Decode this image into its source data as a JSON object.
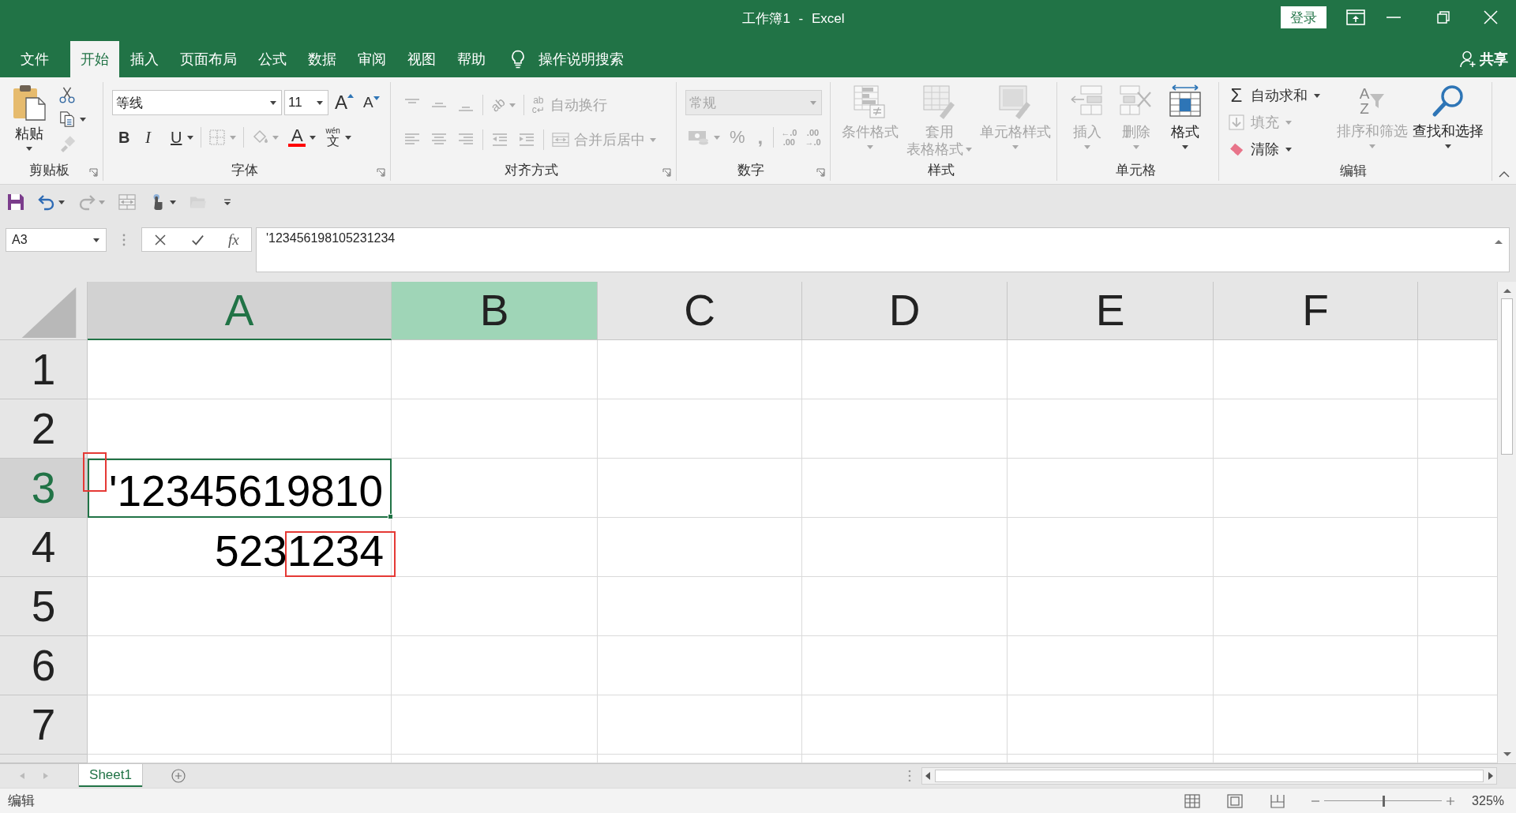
{
  "window": {
    "title": "工作簿1 - Excel",
    "sign_in": "登录"
  },
  "ribbon_tabs": [
    {
      "label": "文件",
      "selected": false
    },
    {
      "label": "开始",
      "selected": true
    },
    {
      "label": "插入",
      "selected": false
    },
    {
      "label": "页面布局",
      "selected": false
    },
    {
      "label": "公式",
      "selected": false
    },
    {
      "label": "数据",
      "selected": false
    },
    {
      "label": "审阅",
      "selected": false
    },
    {
      "label": "视图",
      "selected": false
    },
    {
      "label": "帮助",
      "selected": false
    }
  ],
  "tell_me": {
    "label": "操作说明搜索"
  },
  "share": {
    "label": "共享"
  },
  "ribbon": {
    "clipboard": {
      "label": "剪贴板",
      "paste": {
        "label": "粘贴",
        "disabled": false
      },
      "cut": {
        "disabled": false
      },
      "copy": {
        "disabled": false
      },
      "format_painter": {
        "disabled": true
      }
    },
    "font": {
      "label": "字体",
      "font_name": {
        "value": "等线"
      },
      "font_size": {
        "value": "11"
      },
      "grow": {
        "glyph": "A",
        "disabled": false
      },
      "shrink": {
        "glyph": "A",
        "disabled": false
      },
      "bold": {
        "glyph": "B",
        "disabled": false
      },
      "italic": {
        "glyph": "I",
        "disabled": false
      },
      "underline": {
        "glyph": "U",
        "disabled": false
      },
      "borders": {
        "disabled": true
      },
      "fill_color": {
        "disabled": true
      },
      "font_color": {
        "glyph": "A",
        "color": "#ff0000",
        "disabled": false
      },
      "phonetic": {
        "glyph_top": "wén",
        "glyph_bottom": "文",
        "disabled": false
      }
    },
    "alignment": {
      "label": "对齐方式",
      "top_row": [
        {
          "kind": "top",
          "disabled": true
        },
        {
          "kind": "middle",
          "disabled": true
        },
        {
          "kind": "bottom",
          "disabled": true
        }
      ],
      "orientation": {
        "glyph": "ab",
        "disabled": true
      },
      "wrap_text": {
        "glyph_top": "ab",
        "glyph_bottom": "c↵",
        "label": "自动换行",
        "disabled": true
      },
      "bottom_row": [
        {
          "kind": "left",
          "disabled": true
        },
        {
          "kind": "center",
          "disabled": true
        },
        {
          "kind": "right",
          "disabled": true
        }
      ],
      "indent": [
        {
          "kind": "decrease",
          "disabled": true
        },
        {
          "kind": "increase",
          "disabled": true
        }
      ],
      "merge": {
        "label": "合并后居中",
        "disabled": true
      }
    },
    "number": {
      "label": "数字",
      "format": {
        "value": "常规",
        "disabled": true
      },
      "accounting": {
        "disabled": true
      },
      "percent": {
        "glyph": "%",
        "disabled": true
      },
      "comma": {
        "glyph": ",",
        "disabled": true
      },
      "increase_decimal": {
        "glyph_top": "←.0",
        "glyph_bottom": ".00",
        "disabled": true
      },
      "decrease_decimal": {
        "glyph_top": ".00",
        "glyph_bottom": "→.0",
        "disabled": true
      }
    },
    "styles": {
      "label": "样式",
      "buttons": [
        {
          "kind": "conditional",
          "lines": [
            "条件格式"
          ],
          "disabled": true
        },
        {
          "kind": "table",
          "lines": [
            "套用",
            "表格格式"
          ],
          "disabled": true
        },
        {
          "kind": "cell",
          "lines": [
            "单元格样式"
          ],
          "disabled": true
        }
      ]
    },
    "cells": {
      "label": "单元格",
      "buttons": [
        {
          "kind": "insert",
          "label": "插入",
          "disabled": true
        },
        {
          "kind": "delete",
          "label": "删除",
          "disabled": true
        },
        {
          "kind": "format",
          "label": "格式",
          "disabled": false
        }
      ]
    },
    "editing": {
      "label": "编辑",
      "autosum": {
        "glyph": "Σ",
        "label": "自动求和",
        "disabled": false
      },
      "fill": {
        "label": "填充",
        "disabled": true
      },
      "clear": {
        "label": "清除",
        "disabled": false
      },
      "sort_filter": {
        "glyph_top": "A",
        "glyph_bottom": "Z",
        "label": "排序和筛选",
        "disabled": true
      },
      "find_select": {
        "label": "查找和选择",
        "disabled": false
      }
    }
  },
  "quick_access": [
    {
      "kind": "save",
      "disabled": false
    },
    {
      "kind": "undo",
      "disabled": false
    },
    {
      "kind": "redo",
      "disabled": true
    },
    {
      "kind": "form",
      "disabled": true
    },
    {
      "kind": "touch",
      "disabled": false
    },
    {
      "kind": "open",
      "disabled": true
    },
    {
      "kind": "customize",
      "disabled": false
    }
  ],
  "formula_bar": {
    "name_box": {
      "value": "A3"
    },
    "insert_function": {
      "glyph": "fx"
    },
    "value": "'123456198105231234"
  },
  "sheet": {
    "columns": [
      {
        "label": "A",
        "selected": true,
        "highlighted": false
      },
      {
        "label": "B",
        "selected": false,
        "highlighted": true
      },
      {
        "label": "C",
        "selected": false,
        "highlighted": false
      },
      {
        "label": "D",
        "selected": false,
        "highlighted": false
      },
      {
        "label": "E",
        "selected": false,
        "highlighted": false
      },
      {
        "label": "F",
        "selected": false,
        "highlighted": false
      }
    ],
    "rows": [
      {
        "label": "1",
        "selected": false
      },
      {
        "label": "2",
        "selected": false
      },
      {
        "label": "3",
        "selected": true,
        "cells": [
          {
            "text": "'12345619810",
            "selected": true,
            "frame_first_char": true,
            "frame_last_digits": false
          }
        ]
      },
      {
        "label": "4",
        "selected": false,
        "cells": [
          {
            "text": "5231234",
            "selected": false,
            "frame_first_char": false,
            "frame_last_digits": true
          }
        ]
      },
      {
        "label": "5",
        "selected": false
      },
      {
        "label": "6",
        "selected": false
      },
      {
        "label": "7",
        "selected": false
      }
    ]
  },
  "sheet_tabs": [
    {
      "label": "Sheet1",
      "selected": true
    }
  ],
  "status_bar": {
    "mode": "编辑",
    "views": [
      {
        "kind": "normal",
        "selected": false
      },
      {
        "kind": "page_layout",
        "selected": false
      },
      {
        "kind": "page_break",
        "selected": false
      }
    ],
    "zoom": {
      "level": 0.5,
      "label": "325%"
    }
  }
}
